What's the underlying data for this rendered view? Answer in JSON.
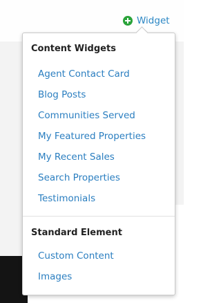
{
  "toolbar": {
    "add_widget_label": "Widget",
    "add_icon": "plus-circle-icon",
    "add_icon_color": "#2aa33a"
  },
  "menu": {
    "sections": [
      {
        "title": "Content Widgets",
        "items": [
          "Agent Contact Card",
          "Blog Posts",
          "Communities Served",
          "My Featured Properties",
          "My Recent Sales",
          "Search Properties",
          "Testimonials"
        ]
      },
      {
        "title": "Standard Element",
        "items": [
          "Custom Content",
          "Images"
        ]
      }
    ]
  },
  "colors": {
    "link": "#2a7ec0",
    "heading": "#222222"
  }
}
